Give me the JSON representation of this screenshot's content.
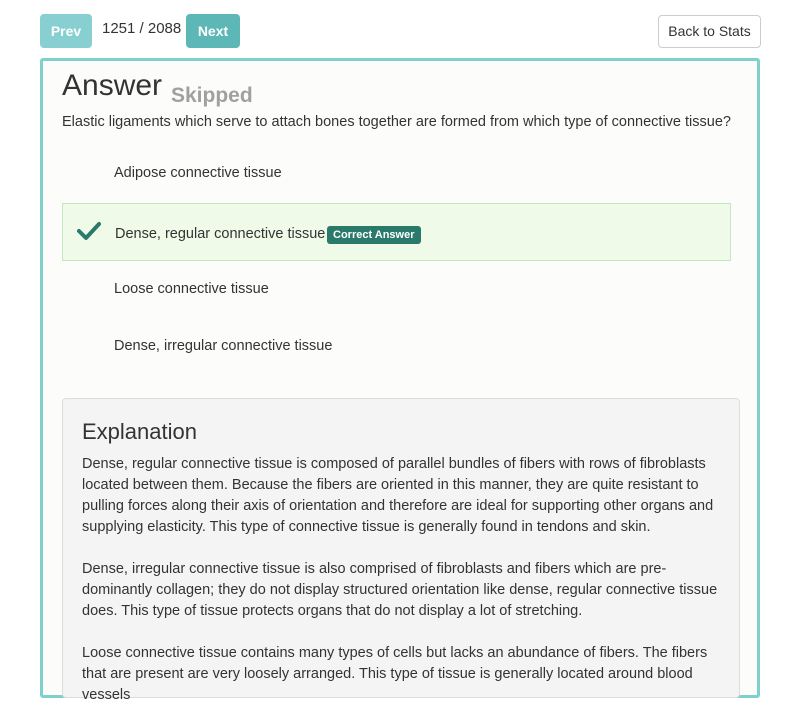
{
  "nav": {
    "prev_label": "Prev",
    "counter": "1251 / 2088",
    "next_label": "Next",
    "back_label": "Back to Stats"
  },
  "answer": {
    "title": "Answer",
    "status": "Skipped",
    "question": "Elastic ligaments which serve to attach bones together are formed from which type of connective tissue?",
    "options": [
      {
        "label": "Adipose connective tissue"
      },
      {
        "label": "Dense, regular connective tissue",
        "badge": "Correct Answer"
      },
      {
        "label": "Loose connective tissue"
      },
      {
        "label": "Dense, irregular connective tissue"
      }
    ]
  },
  "explanation": {
    "title": "Explanation",
    "paragraphs": [
      "Dense, regular connective tissue is composed of parallel bundles of fibers with rows of fibroblasts located between them. Because the fibers are oriented in this manner, they are quite resistant to pulling forces along their axis of orientation and therefore are ideal for supporting other organs and supplying elasticity. This type of connective tissue is generally found in tendons and skin.",
      "Dense, irregular connective tissue is also comprised of fibroblasts and fibers which are pre-dominantly collagen; they do not display structured orientation like dense, regular connective tissue does. This type of tissue protects organs that do not display a lot of stretching.",
      "Loose connective tissue contains many types of cells but lacks an abundance of fibers. The fibers that are present are very loosely arranged. This type of tissue is generally located around blood vessels"
    ]
  },
  "colors": {
    "accent": "#7fcfcc",
    "prev_button": "#87cfd1",
    "next_button": "#5db7b7",
    "correct_bg": "#effbe8",
    "badge": "#2a7a6c",
    "check": "#2a7a6c"
  },
  "icons": {
    "correct": "checkmark-icon"
  }
}
